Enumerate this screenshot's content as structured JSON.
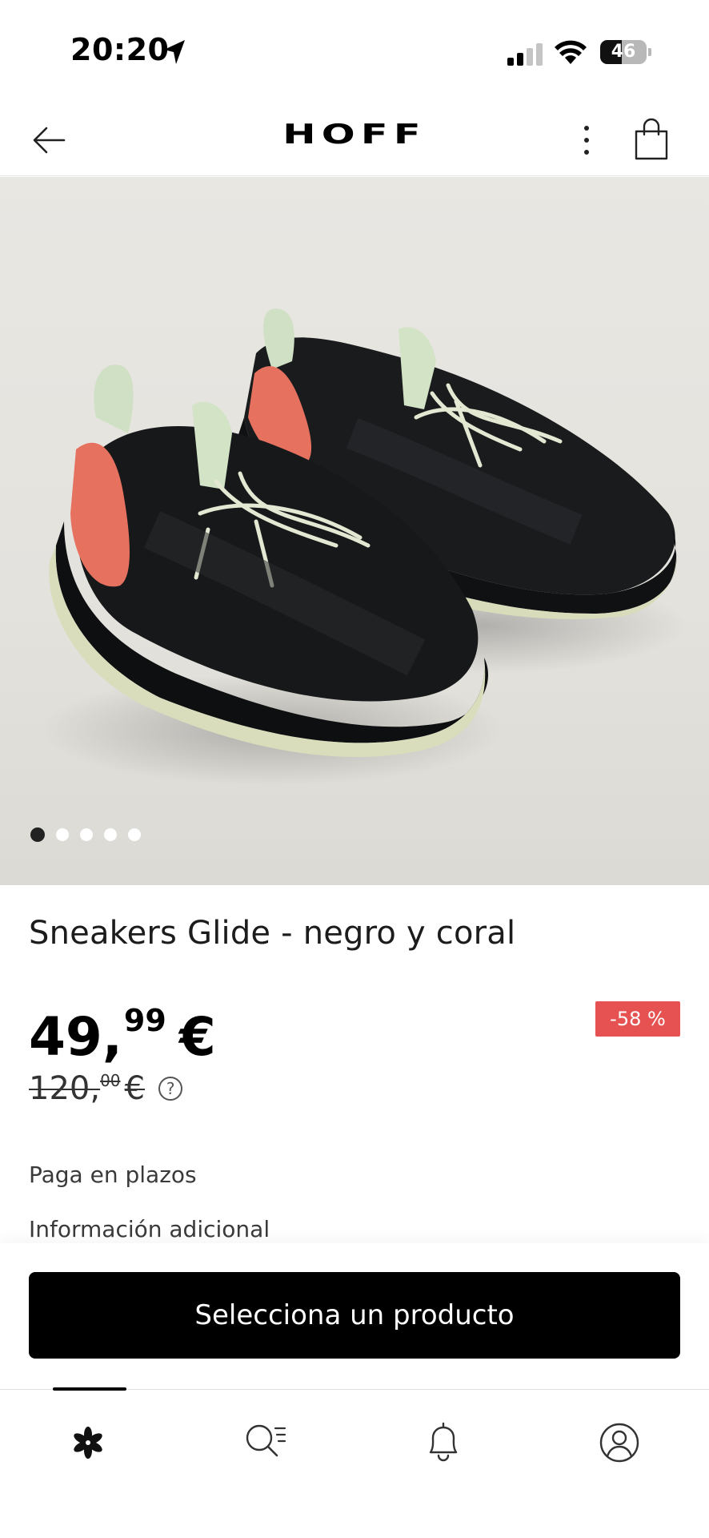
{
  "status_bar": {
    "time": "20:20",
    "battery": "46",
    "battery_level": 0.46
  },
  "header": {
    "brand": "HOFF",
    "icons": [
      "back-arrow-icon",
      "more-vertical-icon",
      "shopping-bag-icon"
    ]
  },
  "gallery": {
    "image_subject": "black and coral knit sneakers pair",
    "total_images": 5,
    "active_index": 0
  },
  "product": {
    "title": "Sneakers Glide - negro y coral",
    "price": {
      "integer": "49,",
      "decimals": "99",
      "currency": "€"
    },
    "old_price": {
      "integer": "120,",
      "decimals": "00",
      "currency": "€"
    },
    "discount": "-58 %",
    "help_symbol": "?",
    "links": {
      "installments": "Paga en plazos",
      "additional_info": "Información adicional"
    }
  },
  "cta": {
    "label": "Selecciona un producto"
  },
  "bottom_nav": {
    "active": "home",
    "items": [
      "home-flower-icon",
      "search-list-icon",
      "bell-icon",
      "account-icon"
    ]
  },
  "colors": {
    "primary": "#000000",
    "discount_badge": "#e55251",
    "hero_background": "#e7e5e0"
  }
}
